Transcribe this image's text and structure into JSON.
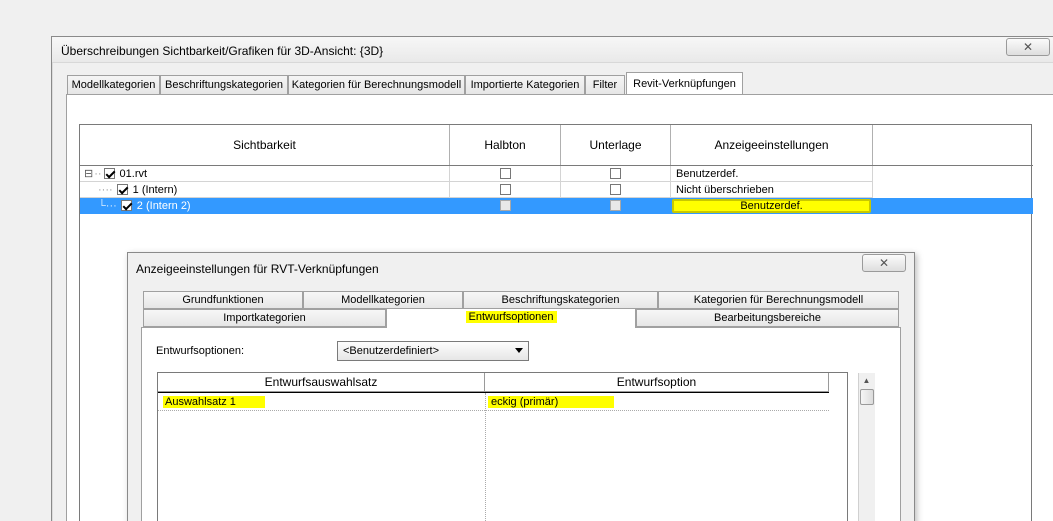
{
  "main_dialog": {
    "title": "Überschreibungen Sichtbarkeit/Grafiken für 3D-Ansicht: {3D}",
    "close_glyph": "✕",
    "tabs": [
      {
        "label": "Modellkategorien"
      },
      {
        "label": "Beschriftungskategorien"
      },
      {
        "label": "Kategorien für Berechnungsmodell"
      },
      {
        "label": "Importierte Kategorien"
      },
      {
        "label": "Filter"
      },
      {
        "label": "Revit-Verknüpfungen",
        "active": true
      }
    ],
    "table": {
      "headers": [
        "Sichtbarkeit",
        "Halbton",
        "Unterlage",
        "Anzeigeeinstellungen"
      ],
      "rows": [
        {
          "name": "01.rvt",
          "visible": true,
          "halftone": false,
          "underlay": false,
          "display": "Benutzerdef.",
          "expander": "⊟"
        },
        {
          "name": "1 (Intern)",
          "visible": true,
          "halftone": false,
          "underlay": false,
          "display": "Nicht überschrieben"
        },
        {
          "name": "2 (Intern 2)",
          "visible": true,
          "halftone": false,
          "underlay": false,
          "display": "Benutzerdef.",
          "selected": true
        }
      ]
    }
  },
  "sub_dialog": {
    "title": "Anzeigeeinstellungen für RVT-Verknüpfungen",
    "close_glyph": "✕",
    "tabs_row1": [
      {
        "label": "Grundfunktionen"
      },
      {
        "label": "Modellkategorien"
      },
      {
        "label": "Beschriftungskategorien"
      },
      {
        "label": "Kategorien für Berechnungsmodell"
      }
    ],
    "tabs_row2": [
      {
        "label": "Importkategorien"
      },
      {
        "label": "Entwurfsoptionen",
        "active": true
      },
      {
        "label": "Bearbeitungsbereiche"
      }
    ],
    "design_options_label": "Entwurfsoptionen:",
    "design_options_value": "<Benutzerdefiniert>",
    "table": {
      "headers": [
        "Entwurfsauswahlsatz",
        "Entwurfsoption"
      ],
      "rows": [
        {
          "set": "Auswahlsatz 1",
          "option": "eckig (primär)"
        }
      ]
    }
  },
  "colors": {
    "selection": "#3399ff",
    "highlight": "#ffff00"
  }
}
